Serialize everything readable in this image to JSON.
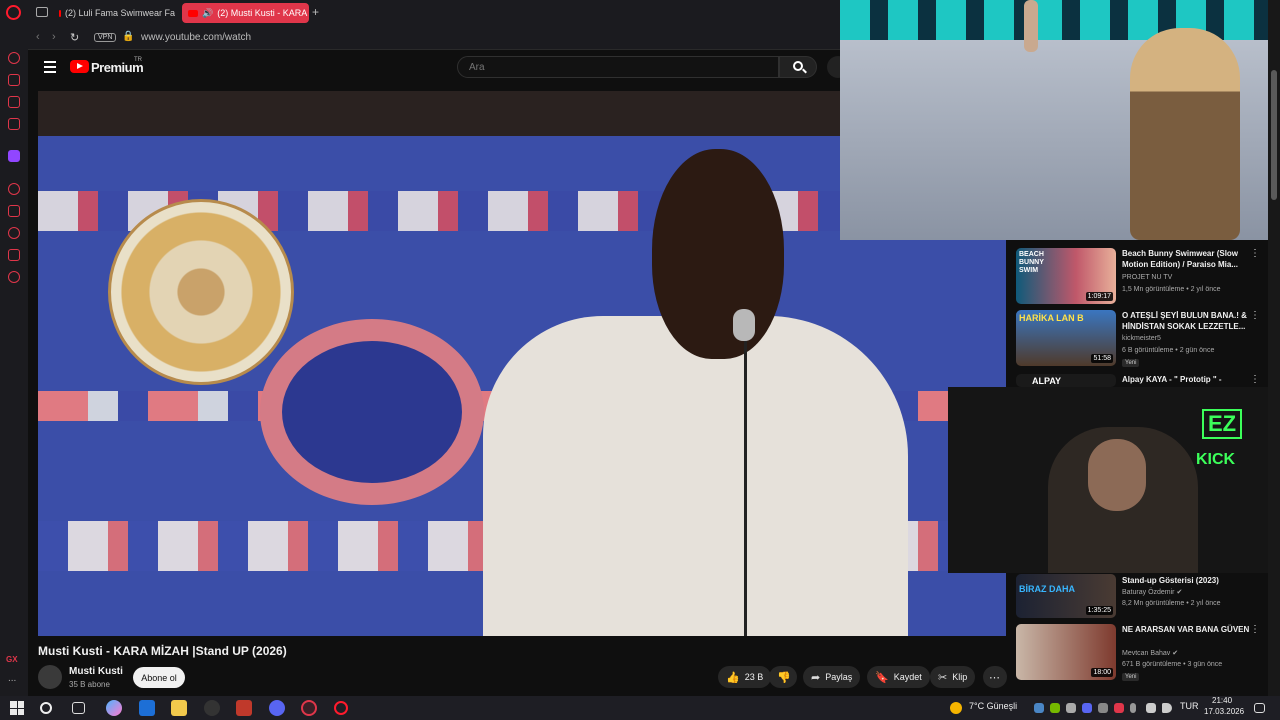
{
  "browser": {
    "tabs": [
      {
        "label": "(2) Luli Fama Swimwear Fa"
      },
      {
        "label": "(2) Musti Kusti - KARA"
      }
    ],
    "vpn_label": "VPN",
    "url": "www.youtube.com/watch",
    "sidebar_gx": "GX",
    "sidebar_more": "..."
  },
  "youtube": {
    "brand": "Premium",
    "brand_suffix": "TR",
    "search_placeholder": "Ara"
  },
  "video": {
    "title": "Musti Kusti - KARA MİZAH  |Stand UP (2026)",
    "channel": "Musti Kusti",
    "subscribers": "35 B abone",
    "subscribe_label": "Abone ol",
    "likes": "23 B",
    "share_label": "Paylaş",
    "save_label": "Kaydet",
    "clip_label": "Klip"
  },
  "recommendations": [
    {
      "title": "Beach Bunny Swimwear (Slow Motion Edition) / Paraiso Mia...",
      "channel": "PROJET NU TV",
      "meta": "1,5 Mn görüntüleme • 2 yıl önce",
      "duration": "1:09:17",
      "thumb_text": "BEACH BUNNY SWIM",
      "badge": ""
    },
    {
      "title": "O ATEŞLİ ŞEYİ BULUN BANA.! & HİNDİSTAN SOKAK LEZZETLE...",
      "channel": "kickmeister5",
      "meta": "6 B görüntüleme • 2 gün önce",
      "duration": "51:58",
      "thumb_text": "HARİKA LAN B",
      "badge": "Yeni"
    },
    {
      "title": "Alpay KAYA - \" Prototip \" -",
      "channel": "",
      "meta": "",
      "duration": "",
      "thumb_text": "ALPAY",
      "badge": ""
    },
    {
      "title": "Stand-up Gösterisi (2023)",
      "channel": "Baturay Özdemir ✔",
      "meta": "8,2 Mn görüntüleme • 2 yıl önce",
      "duration": "1:35:25",
      "thumb_text": "BİRAZ DAHA",
      "badge": ""
    },
    {
      "title": "NE ARARSAN VAR BANA GÜVEN",
      "channel": "Mevtcan Bahav ✔",
      "meta": "671 B görüntüleme • 3 gün önce",
      "duration": "18:00",
      "thumb_text": "",
      "badge": "Yeni"
    }
  ],
  "overlays": {
    "kick_logo_top": "EZ",
    "kick_logo_bottom": "KICK"
  },
  "taskbar": {
    "weather": "7°C  Güneşli",
    "lang": "TUR",
    "time": "21:40",
    "date": "17.03.2026"
  },
  "colors": {
    "accent": "#e0364a",
    "youtube_red": "#ff0000",
    "kick_green": "#3cff5a"
  }
}
